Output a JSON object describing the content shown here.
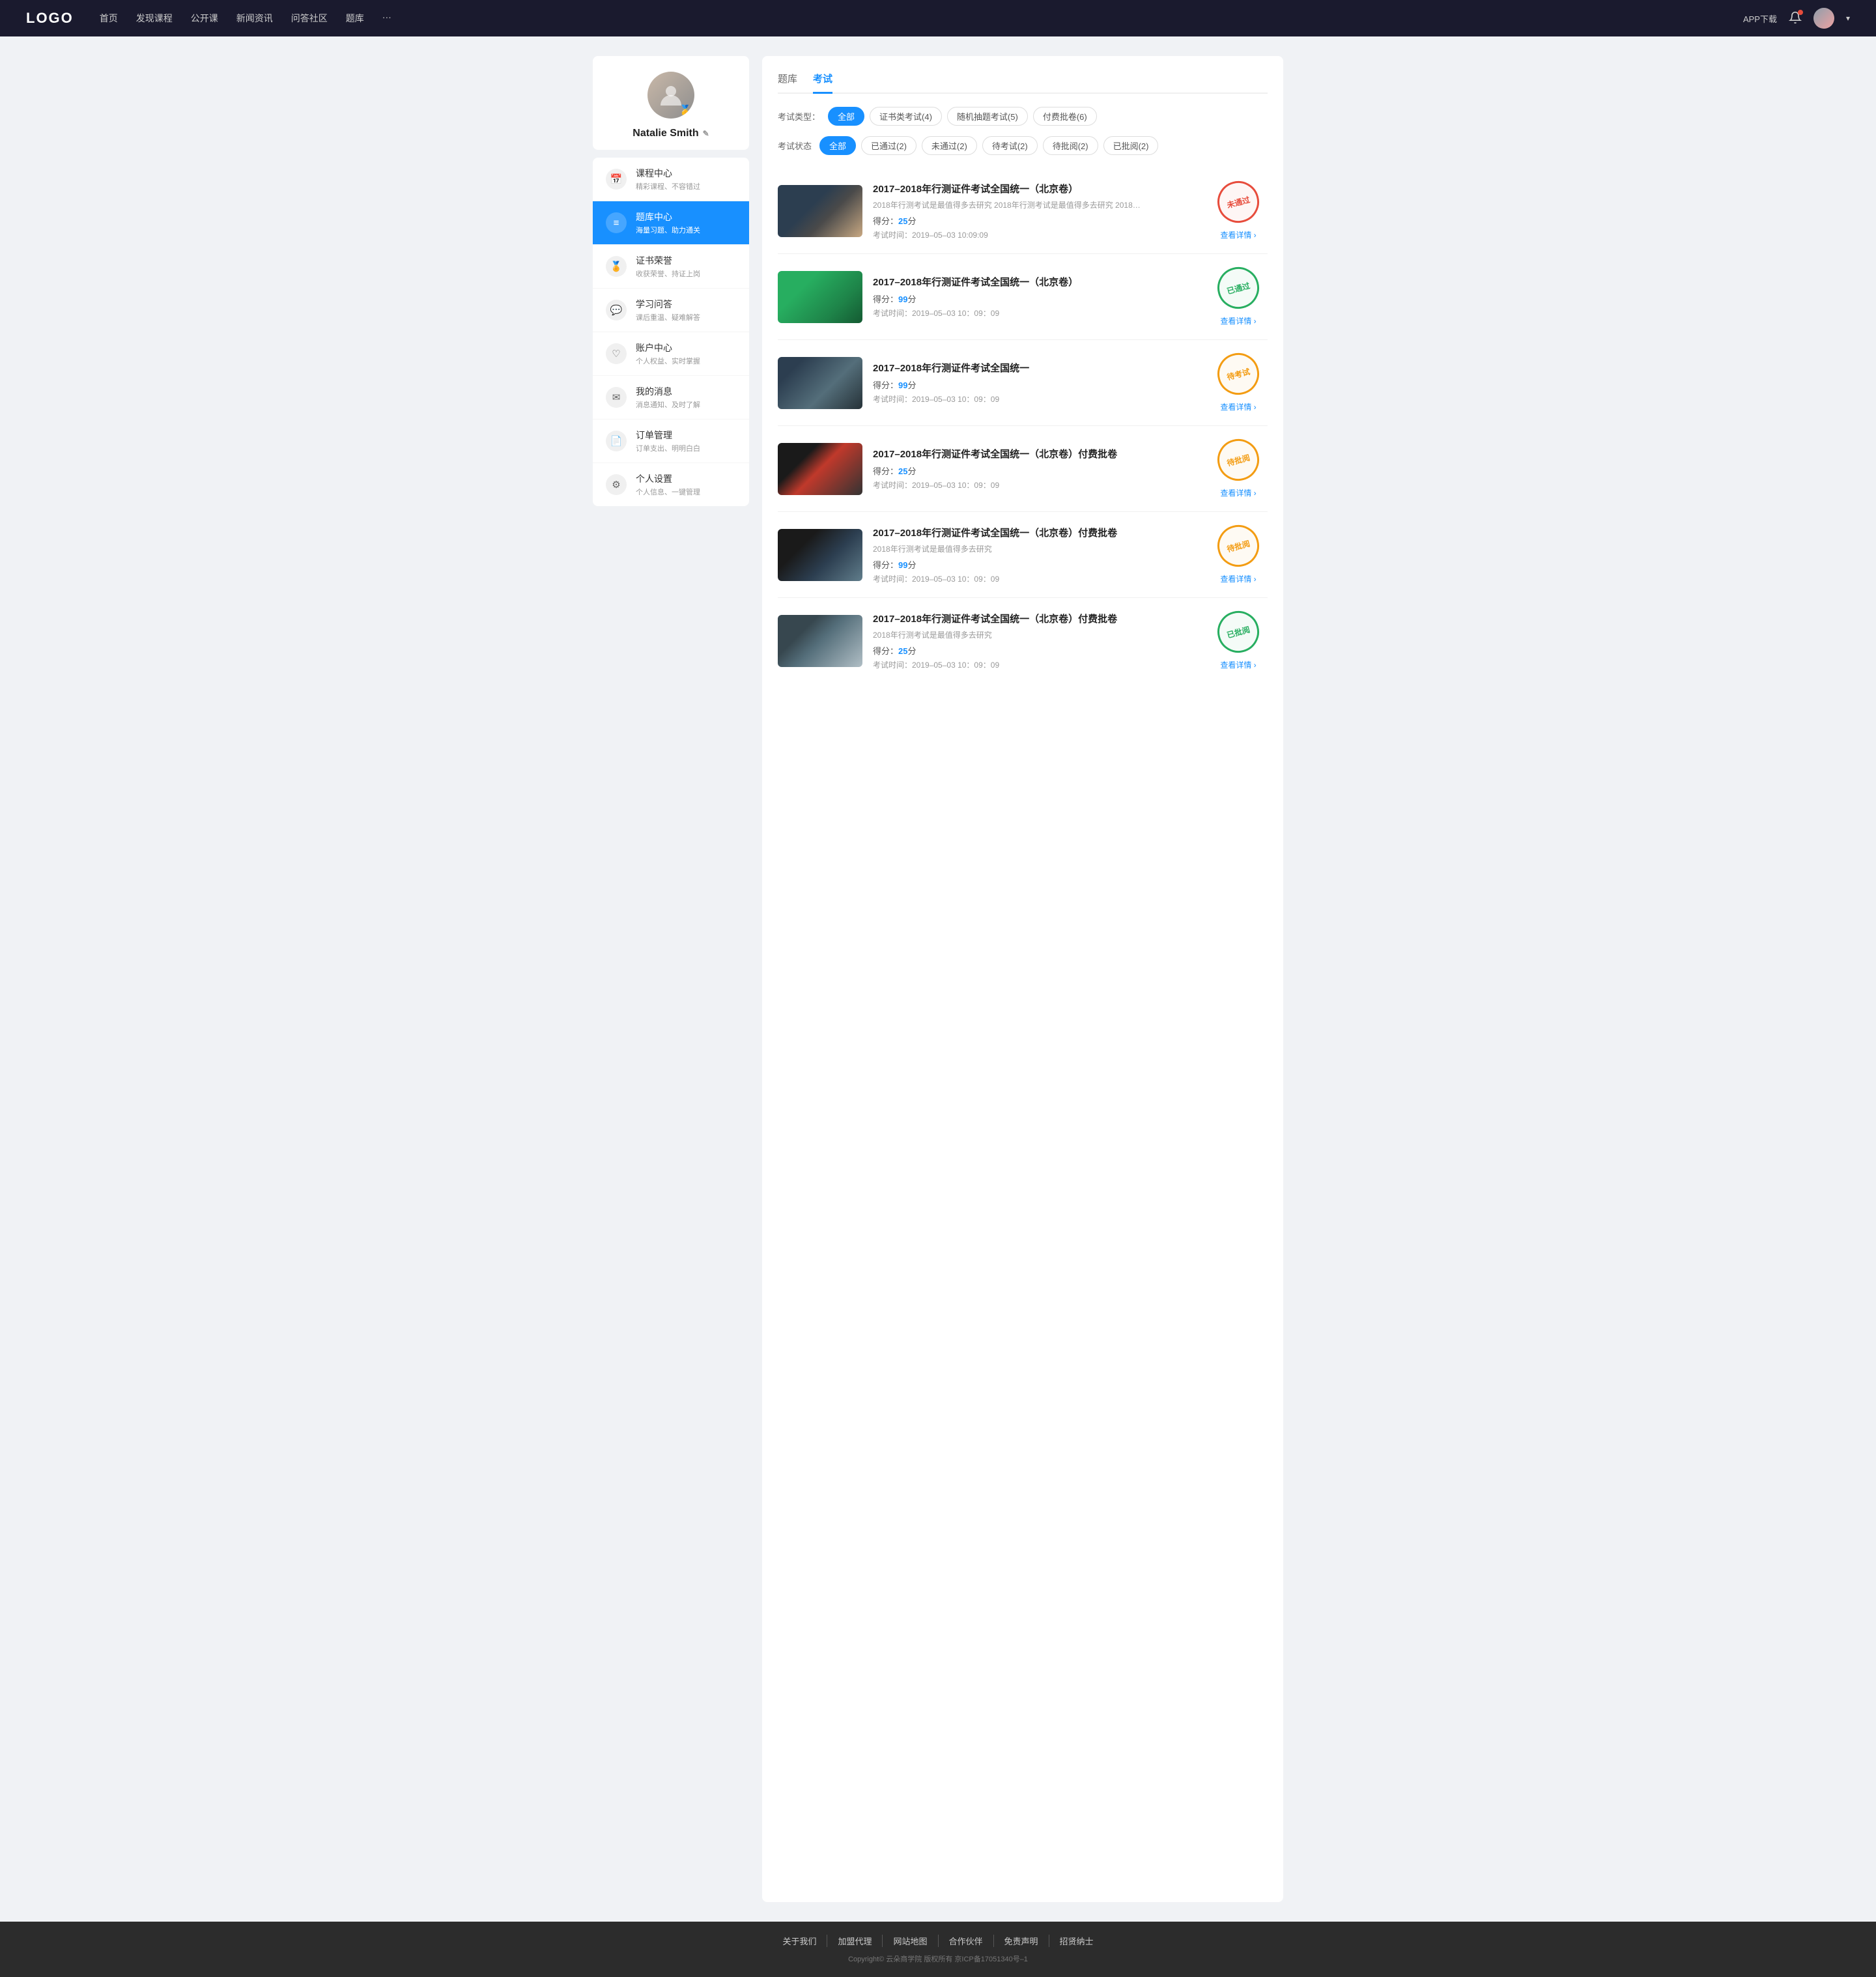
{
  "site": {
    "logo": "LOGO"
  },
  "navbar": {
    "links": [
      {
        "label": "首页",
        "href": "#"
      },
      {
        "label": "发现课程",
        "href": "#"
      },
      {
        "label": "公开课",
        "href": "#"
      },
      {
        "label": "新闻资讯",
        "href": "#"
      },
      {
        "label": "问答社区",
        "href": "#"
      },
      {
        "label": "题库",
        "href": "#"
      },
      {
        "label": "···",
        "href": "#"
      }
    ],
    "app_download": "APP下载"
  },
  "sidebar": {
    "user": {
      "name": "Natalie Smith",
      "edit_icon": "✎"
    },
    "menu": [
      {
        "id": "course",
        "icon": "📅",
        "title": "课程中心",
        "subtitle": "精彩课程、不容错过",
        "active": false
      },
      {
        "id": "question",
        "icon": "≡",
        "title": "题库中心",
        "subtitle": "海量习题、助力通关",
        "active": true
      },
      {
        "id": "cert",
        "icon": "🏅",
        "title": "证书荣誉",
        "subtitle": "收获荣誉、持证上岗",
        "active": false
      },
      {
        "id": "qa",
        "icon": "💬",
        "title": "学习问答",
        "subtitle": "课后重温、疑难解答",
        "active": false
      },
      {
        "id": "account",
        "icon": "♡",
        "title": "账户中心",
        "subtitle": "个人权益、实时掌握",
        "active": false
      },
      {
        "id": "message",
        "icon": "✉",
        "title": "我的消息",
        "subtitle": "消息通知、及时了解",
        "active": false
      },
      {
        "id": "order",
        "icon": "📄",
        "title": "订单管理",
        "subtitle": "订单支出、明明白白",
        "active": false
      },
      {
        "id": "settings",
        "icon": "⚙",
        "title": "个人设置",
        "subtitle": "个人信息、一键管理",
        "active": false
      }
    ]
  },
  "content": {
    "top_tabs": [
      {
        "label": "题库",
        "active": false
      },
      {
        "label": "考试",
        "active": true
      }
    ],
    "type_filter": {
      "label": "考试类型：",
      "options": [
        {
          "label": "全部",
          "active": true
        },
        {
          "label": "证书类考试(4)",
          "active": false
        },
        {
          "label": "随机抽题考试(5)",
          "active": false
        },
        {
          "label": "付费批卷(6)",
          "active": false
        }
      ]
    },
    "status_filter": {
      "label": "考试状态",
      "options": [
        {
          "label": "全部",
          "active": true
        },
        {
          "label": "已通过(2)",
          "active": false
        },
        {
          "label": "未通过(2)",
          "active": false
        },
        {
          "label": "待考试(2)",
          "active": false
        },
        {
          "label": "待批阅(2)",
          "active": false
        },
        {
          "label": "已批阅(2)",
          "active": false
        }
      ]
    },
    "exams": [
      {
        "id": 1,
        "thumb_class": "thumb-1",
        "title": "2017–2018年行测证件考试全国统一（北京卷）",
        "desc": "2018年行测考试是最值得多去研究 2018年行测考试是最值得多去研究 2018年行…",
        "score_label": "得分：",
        "score": "25",
        "score_unit": "分",
        "time_label": "考试时间：",
        "time": "2019–05–03  10:09:09",
        "status_label": "未通过",
        "status_class": "stamp-fail",
        "view_label": "查看详情"
      },
      {
        "id": 2,
        "thumb_class": "thumb-2",
        "title": "2017–2018年行测证件考试全国统一（北京卷）",
        "desc": "",
        "score_label": "得分：",
        "score": "99",
        "score_unit": "分",
        "time_label": "考试时间：",
        "time": "2019–05–03  10：09：09",
        "status_label": "已通过",
        "status_class": "stamp-pass",
        "view_label": "查看详情"
      },
      {
        "id": 3,
        "thumb_class": "thumb-3",
        "title": "2017–2018年行测证件考试全国统一",
        "desc": "",
        "score_label": "得分：",
        "score": "99",
        "score_unit": "分",
        "time_label": "考试时间：",
        "time": "2019–05–03  10：09：09",
        "status_label": "待考试",
        "status_class": "stamp-pending",
        "view_label": "查看详情"
      },
      {
        "id": 4,
        "thumb_class": "thumb-4",
        "title": "2017–2018年行测证件考试全国统一（北京卷）付费批卷",
        "desc": "",
        "score_label": "得分：",
        "score": "25",
        "score_unit": "分",
        "time_label": "考试时间：",
        "time": "2019–05–03  10：09：09",
        "status_label": "待批阅",
        "status_class": "stamp-review",
        "view_label": "查看详情"
      },
      {
        "id": 5,
        "thumb_class": "thumb-5",
        "title": "2017–2018年行测证件考试全国统一（北京卷）付费批卷",
        "desc": "2018年行测考试是最值得多去研究",
        "score_label": "得分：",
        "score": "99",
        "score_unit": "分",
        "time_label": "考试时间：",
        "time": "2019–05–03  10：09：09",
        "status_label": "待批阅",
        "status_class": "stamp-review",
        "view_label": "查看详情"
      },
      {
        "id": 6,
        "thumb_class": "thumb-6",
        "title": "2017–2018年行测证件考试全国统一（北京卷）付费批卷",
        "desc": "2018年行测考试是最值得多去研究",
        "score_label": "得分：",
        "score": "25",
        "score_unit": "分",
        "time_label": "考试时间：",
        "time": "2019–05–03  10：09：09",
        "status_label": "已批阅",
        "status_class": "stamp-reviewed",
        "view_label": "查看详情"
      }
    ]
  },
  "footer": {
    "links": [
      "关于我们",
      "加盟代理",
      "网站地图",
      "合作伙伴",
      "免责声明",
      "招贤纳士"
    ],
    "copyright": "Copyright© 云朵商学院  版权所有    京ICP备17051340号–1"
  }
}
